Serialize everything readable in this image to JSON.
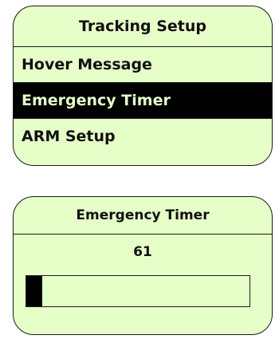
{
  "menu_screen": {
    "title": "Tracking Setup",
    "items": [
      {
        "label": "Hover Message",
        "selected": false
      },
      {
        "label": "Emergency Timer",
        "selected": true
      },
      {
        "label": "ARM Setup",
        "selected": false
      }
    ]
  },
  "timer_screen": {
    "title": "Emergency Timer",
    "value": "61",
    "progress_fraction": 0.07
  },
  "colors": {
    "screen_background": "#e6ffc8",
    "selection_background": "#000000",
    "border": "#1a1a1a"
  }
}
